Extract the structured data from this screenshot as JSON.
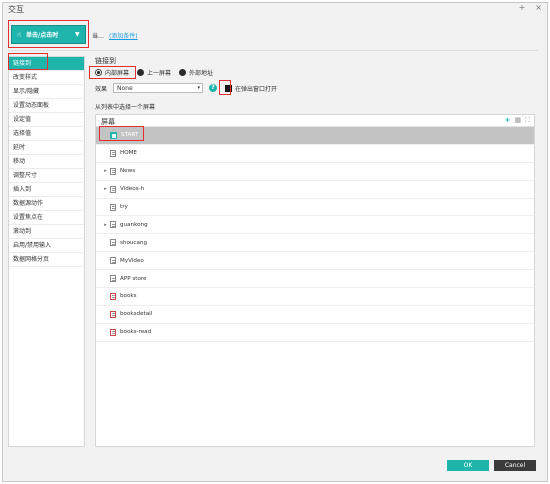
{
  "window": {
    "title": "交互",
    "btn_add": "+",
    "btn_close": "×"
  },
  "event": {
    "label": "单击/点击时",
    "hand_icon": "hand-pointer-icon"
  },
  "when": {
    "prefix": "当…",
    "link": "(添加条件)"
  },
  "actions": [
    "链接到",
    "改变样式",
    "显示/隐藏",
    "设置动态面板",
    "设定值",
    "选择值",
    "延时",
    "移动",
    "调整尺寸",
    "插入到",
    "数据源动作",
    "设置焦点在",
    "滚动到",
    "启用/禁用输入",
    "数据网格分页"
  ],
  "active_action_index": 0,
  "link": {
    "section_title": "链接到",
    "options": [
      "内部屏幕",
      "上一屏幕",
      "外部地址"
    ],
    "selected_option": 0,
    "effect_label": "效果",
    "effect_value": "None",
    "popup_label": "在弹出窗口打开",
    "choose_text": "从列表中选择一个屏幕"
  },
  "tree": {
    "header": "屏幕",
    "tools": {
      "add": "+",
      "delete": "▦",
      "expand": "⛶"
    },
    "rows": [
      {
        "name": "START",
        "expandable": false,
        "icon": "home-page-icon"
      },
      {
        "name": "HOME",
        "expandable": false,
        "icon": "page-icon"
      },
      {
        "name": "News",
        "expandable": true,
        "icon": "page-icon"
      },
      {
        "name": "Videos-h",
        "expandable": true,
        "icon": "page-icon"
      },
      {
        "name": "try",
        "expandable": false,
        "icon": "page-icon"
      },
      {
        "name": "guankong",
        "expandable": true,
        "icon": "page-icon"
      },
      {
        "name": "shoucang",
        "expandable": false,
        "icon": "page-icon"
      },
      {
        "name": "MyVideo",
        "expandable": false,
        "icon": "page-icon"
      },
      {
        "name": "APP store",
        "expandable": false,
        "icon": "page-icon"
      },
      {
        "name": "books",
        "expandable": false,
        "icon": "page-red-icon"
      },
      {
        "name": "booksdetail",
        "expandable": false,
        "icon": "page-red-icon"
      },
      {
        "name": "books-read",
        "expandable": false,
        "icon": "page-red-icon"
      }
    ],
    "selected_index": 0
  },
  "footer": {
    "ok": "OK",
    "cancel": "Cancel"
  },
  "colors": {
    "accent": "#1fb5ad",
    "highlight": "#e03030",
    "selected_row": "#c3c3c3"
  }
}
